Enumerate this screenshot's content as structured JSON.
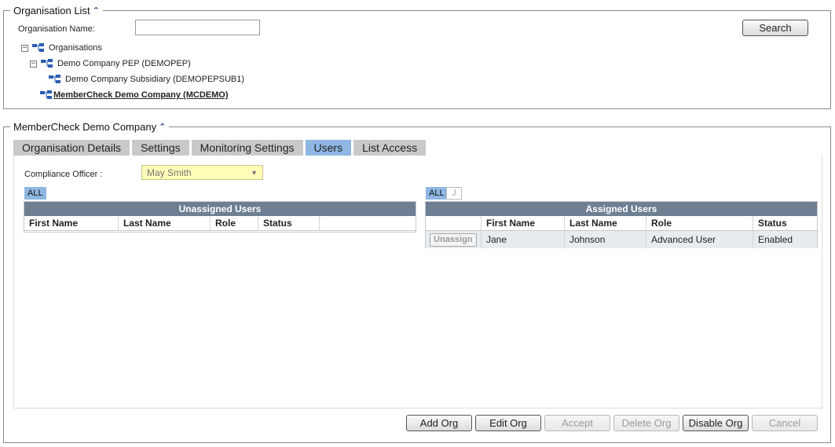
{
  "org_list": {
    "title": "Organisation List",
    "name_label": "Organisation Name:",
    "name_value": "",
    "search_label": "Search",
    "tree": [
      {
        "label": "Organisations",
        "expander": "−"
      },
      {
        "label": "Demo Company PEP (DEMOPEP)",
        "expander": "−"
      },
      {
        "label": "Demo Company Subsidiary (DEMOPEPSUB1)"
      },
      {
        "label": "MemberCheck Demo Company (MCDEMO)",
        "selected": true
      }
    ],
    "icons": {
      "collapse": "chevron-double-up-icon",
      "org": "org-hierarchy-icon"
    }
  },
  "company": {
    "title": "MemberCheck Demo Company",
    "tabs": [
      {
        "label": "Organisation Details"
      },
      {
        "label": "Settings"
      },
      {
        "label": "Monitoring Settings"
      },
      {
        "label": "Users",
        "active": true
      },
      {
        "label": "List Access"
      }
    ],
    "compliance_label": "Compliance Officer :",
    "compliance_value": "May Smith",
    "unassigned": {
      "filters": [
        "ALL"
      ],
      "title": "Unassigned Users",
      "columns": [
        "First Name",
        "Last Name",
        "Role",
        "Status"
      ]
    },
    "assigned": {
      "filters": [
        "ALL",
        "J"
      ],
      "title": "Assigned Users",
      "columns": [
        "",
        "First Name",
        "Last Name",
        "Role",
        "Status"
      ],
      "rows": [
        {
          "action": "Unassign",
          "first": "Jane",
          "last": "Johnson",
          "role": "Advanced User",
          "status": "Enabled"
        }
      ]
    },
    "actions": {
      "add": "Add Org",
      "edit": "Edit Org",
      "accept": "Accept",
      "delete": "Delete Org",
      "disable": "Disable Org",
      "cancel": "Cancel"
    }
  },
  "colors": {
    "tab_active": "#8fb7e3",
    "tab_inactive": "#c9c9c9",
    "grid_title": "#6e7f93",
    "select_bg": "#fffdb8"
  }
}
